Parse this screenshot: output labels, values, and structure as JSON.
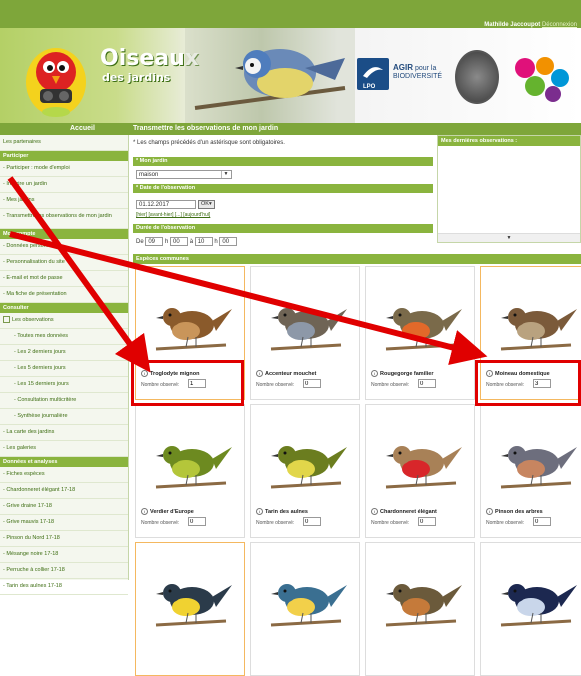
{
  "user": {
    "name": "Mathilde Jaccoupot",
    "logout": "Déconnexion"
  },
  "brand": {
    "line1": "Oiseaux",
    "line2": "des jardins"
  },
  "partners": {
    "lpo": "LPO",
    "agir_line1": "AGIR",
    "agir_line2": "pour la",
    "agir_line3": "BIODIVERSITÉ"
  },
  "nav": {
    "home": "Accueil",
    "page_title": "Transmettre les observations de mon jardin"
  },
  "sidebar": {
    "items": [
      {
        "type": "item",
        "label": "Les partenaires"
      },
      {
        "type": "section",
        "label": "Participer"
      },
      {
        "type": "item",
        "label": "- Participer : mode d'emploi"
      },
      {
        "type": "item",
        "label": "- Inscrire un jardin"
      },
      {
        "type": "item",
        "label": "- Mes jardins"
      },
      {
        "type": "item_tall",
        "label": "- Transmettre les observations de mon jardin"
      },
      {
        "type": "section",
        "label": "Mon compte"
      },
      {
        "type": "item",
        "label": "- Données personnelles"
      },
      {
        "type": "item",
        "label": "- Personnalisation du site"
      },
      {
        "type": "item",
        "label": "- E-mail et mot de passe"
      },
      {
        "type": "item",
        "label": "- Ma fiche de présentation"
      },
      {
        "type": "section",
        "label": "Consulter"
      },
      {
        "type": "item_box",
        "label": "Les observations"
      },
      {
        "type": "sub",
        "label": "- Toutes mes données"
      },
      {
        "type": "sub",
        "label": "- Les 2 derniers jours"
      },
      {
        "type": "sub",
        "label": "- Les 5 derniers jours"
      },
      {
        "type": "sub",
        "label": "- Les 15 derniers jours"
      },
      {
        "type": "sub",
        "label": "- Consultation multicritère"
      },
      {
        "type": "sub",
        "label": "- Synthèse journalière"
      },
      {
        "type": "item",
        "label": "- La carte des jardins"
      },
      {
        "type": "item",
        "label": "- Les galeries"
      },
      {
        "type": "section",
        "label": "Données et analyses"
      },
      {
        "type": "item",
        "label": "- Fiches espèces"
      },
      {
        "type": "item",
        "label": "- Chardonneret élégant 17-18"
      },
      {
        "type": "item",
        "label": "- Grive draine 17-18"
      },
      {
        "type": "item",
        "label": "- Grive mauvis 17-18"
      },
      {
        "type": "item",
        "label": "- Pinson du Nord 17-18"
      },
      {
        "type": "item",
        "label": "- Mésange noire 17-18"
      },
      {
        "type": "item",
        "label": "- Perruche à collier 17-18"
      },
      {
        "type": "item",
        "label": "- Tarin des aulnes 17-18"
      }
    ]
  },
  "form": {
    "required_note": "* Les champs précédés d'un astérisque sont obligatoires.",
    "garden_label": "* Mon jardin",
    "garden_value": "maison",
    "date_label": "* Date de l'observation",
    "date_value": "01.12.2017",
    "ok_label": "OK",
    "quick_dates": "[hier] [avant-hier] [...] [aujourd'hui]",
    "time_label": "Durée de l'observation",
    "time_prefix": "De",
    "time_from_h": "09",
    "time_from_m": "00",
    "time_sep": "à",
    "time_to_h": "10",
    "time_to_m": "00",
    "species_header": "Espèces communes"
  },
  "right_panel": {
    "title": "Mes dernières observations :"
  },
  "count_label": "Nombre observé:",
  "species": [
    {
      "name": "Troglodyte mignon",
      "count": "1",
      "highlight": true
    },
    {
      "name": "Accenteur mouchet",
      "count": "0",
      "highlight": false
    },
    {
      "name": "Rougegorge familier",
      "count": "0",
      "highlight": false
    },
    {
      "name": "Moineau domestique",
      "count": "3",
      "highlight": true
    },
    {
      "name": "Verdier d'Europe",
      "count": "0",
      "highlight": false
    },
    {
      "name": "Tarin des aulnes",
      "count": "0",
      "highlight": false
    },
    {
      "name": "Chardonneret élégant",
      "count": "0",
      "highlight": false
    },
    {
      "name": "Pinson des arbres",
      "count": "0",
      "highlight": false
    },
    {
      "name": "",
      "count": "",
      "highlight": true
    },
    {
      "name": "",
      "count": "",
      "highlight": false
    },
    {
      "name": "",
      "count": "",
      "highlight": false
    },
    {
      "name": "",
      "count": "",
      "highlight": false
    }
  ],
  "colors": {
    "accent_green": "#7ea63a",
    "annotation_red": "#e00000",
    "highlight_orange": "#f4b860"
  }
}
